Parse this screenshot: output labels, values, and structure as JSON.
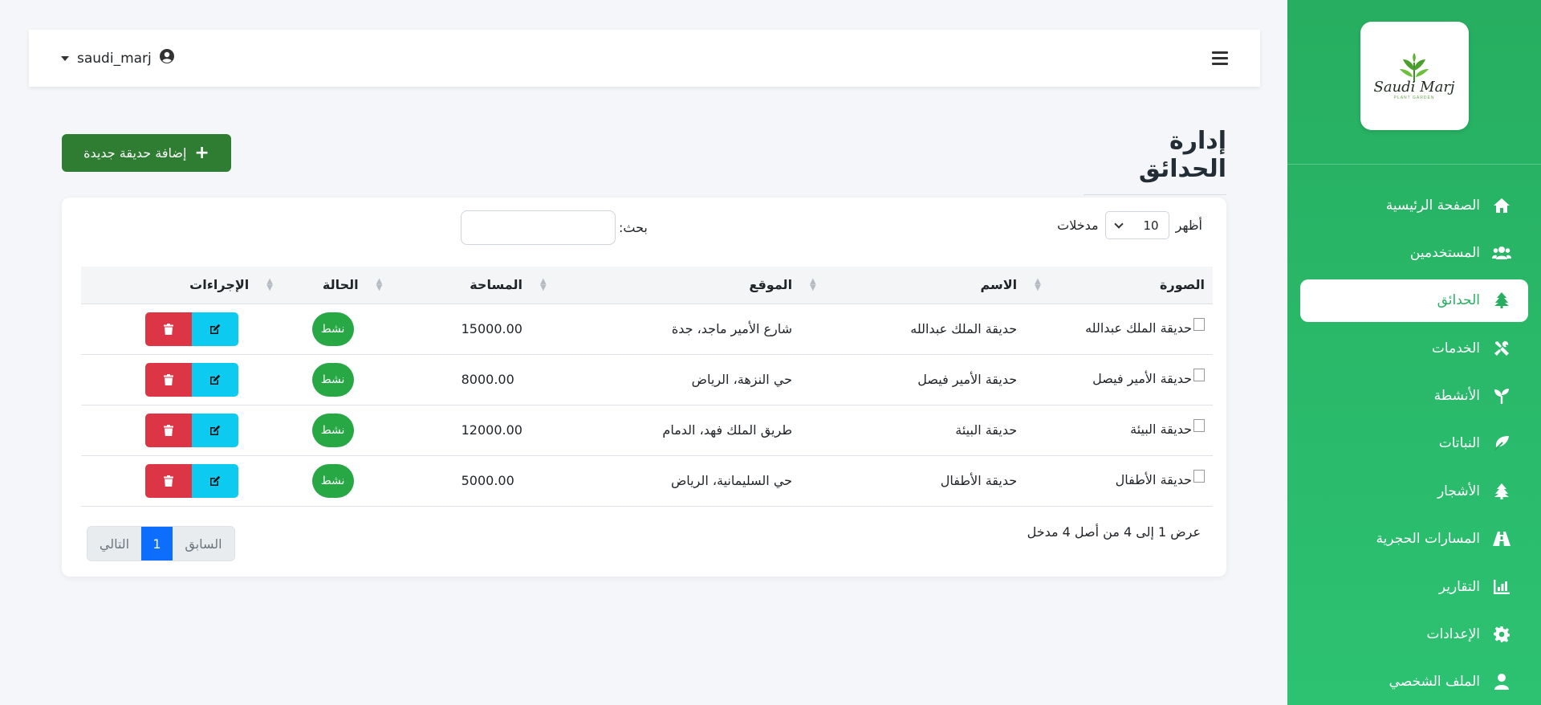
{
  "app": {
    "logo_script": "Saudi Marj",
    "logo_sub": "PLANT GARDEN"
  },
  "sidebar": {
    "items": [
      {
        "label": "الصفحة الرئيسية",
        "icon": "home-icon",
        "active": false
      },
      {
        "label": "المستخدمين",
        "icon": "users-icon",
        "active": false
      },
      {
        "label": "الحدائق",
        "icon": "tree-icon",
        "active": true
      },
      {
        "label": "الخدمات",
        "icon": "tools-icon",
        "active": false
      },
      {
        "label": "الأنشطة",
        "icon": "seedling-icon",
        "active": false
      },
      {
        "label": "النباتات",
        "icon": "leaf-icon",
        "active": false
      },
      {
        "label": "الأشجار",
        "icon": "tree-icon",
        "active": false
      },
      {
        "label": "المسارات الحجرية",
        "icon": "road-icon",
        "active": false
      },
      {
        "label": "التقارير",
        "icon": "chart-icon",
        "active": false
      },
      {
        "label": "الإعدادات",
        "icon": "gear-icon",
        "active": false
      },
      {
        "label": "الملف الشخصي",
        "icon": "user-icon",
        "active": false
      }
    ]
  },
  "topbar": {
    "username": "saudi_marj"
  },
  "page": {
    "title": "إدارة الحدائق",
    "add_button": "إضافة حديقة جديدة"
  },
  "table_controls": {
    "show_label": "أظهر",
    "page_size": "10",
    "entries_label": "مدخلات",
    "search_label": "بحث:",
    "search_value": ""
  },
  "table": {
    "headers": {
      "image": "الصورة",
      "name": "الاسم",
      "location": "الموقع",
      "area": "المساحة",
      "status": "الحالة",
      "actions": "الإجراءات"
    },
    "rows": [
      {
        "image_alt": "حديقة الملك عبدالله",
        "name": "حديقة الملك عبدالله",
        "location": "شارع الأمير ماجد، جدة",
        "area": "15000.00",
        "status": "نشط"
      },
      {
        "image_alt": "حديقة الأمير فيصل",
        "name": "حديقة الأمير فيصل",
        "location": "حي النزهة، الرياض",
        "area": "8000.00",
        "status": "نشط"
      },
      {
        "image_alt": "حديقة البيئة",
        "name": "حديقة البيئة",
        "location": "طريق الملك فهد، الدمام",
        "area": "12000.00",
        "status": "نشط"
      },
      {
        "image_alt": "حديقة الأطفال",
        "name": "حديقة الأطفال",
        "location": "حي السليمانية، الرياض",
        "area": "5000.00",
        "status": "نشط"
      }
    ]
  },
  "footer": {
    "info": "عرض 1 إلى 4 من أصل 4 مدخل",
    "prev": "السابق",
    "current": "1",
    "next": "التالي"
  },
  "colors": {
    "sidebar": "#27ae60",
    "add_button": "#2e7d32",
    "status_badge": "#28a745",
    "edit_button": "#0dcaf0",
    "delete_button": "#dc3545",
    "pager_active": "#0d6efd"
  }
}
